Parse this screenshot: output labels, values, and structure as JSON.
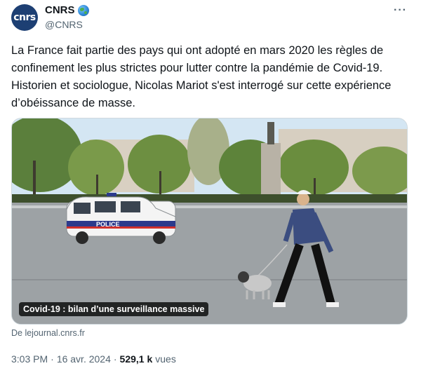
{
  "account": {
    "avatar_text": "cnrs",
    "display_name": "CNRS",
    "handle": "@CNRS",
    "badge_icon": "globe-icon"
  },
  "tweet": {
    "text": "La France fait partie des pays qui ont adopté en mars 2020 les règles de confinement les plus strictes pour lutter contre la pandémie de Covid-19. Historien et sociologue, Nicolas Mariot s'est interrogé sur cette expérience d’obéissance de masse.",
    "media_caption": "Covid-19 : bilan d’une surveillance massive",
    "van_label": "POLICE",
    "source": "De lejournal.cnrs.fr"
  },
  "meta": {
    "time": "3:03 PM",
    "separator": "·",
    "date": "16 avr. 2024",
    "views_count": "529,1 k",
    "views_label": "vues"
  },
  "colors": {
    "avatar_bg": "#1d3f73",
    "text": "#0f1419",
    "secondary": "#536471"
  }
}
